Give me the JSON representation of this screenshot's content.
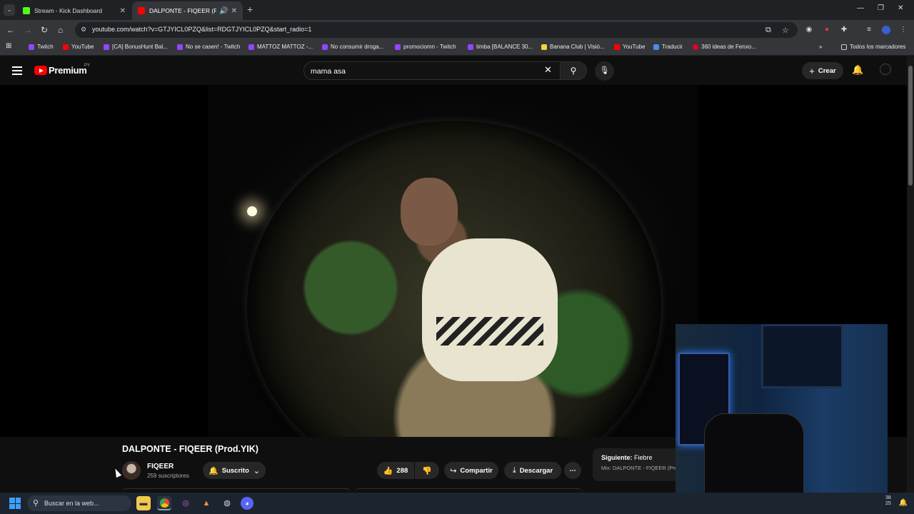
{
  "browser": {
    "tabs": [
      {
        "title": "Stream - Kick Dashboard",
        "icon": "kick-icon",
        "color": "#53fc18"
      },
      {
        "title": "DALPONTE - FIQEER (Prod.",
        "icon": "youtube-icon",
        "color": "#ff0000"
      }
    ],
    "url": "youtube.com/watch?v=GTJYICL0PZQ&list=RDGTJYICL0PZQ&start_radio=1",
    "bookmarks": [
      "Twitch",
      "YouTube",
      "[CA] BonusHunt Bal...",
      "No se casen! - Twitch",
      "MATTOZ MATTOZ -...",
      "No consumir droga...",
      "promociomn - Twitch",
      "timba [BALANCE 30...",
      "Banana Club | Visió...",
      "YouTube",
      "Traducir",
      "360 ideas de Fenxo..."
    ],
    "all_bookmarks": "Todos los marcadores"
  },
  "youtube": {
    "logo_text": "Premium",
    "country": "PY",
    "search_value": "mama asa",
    "create_label": "Crear",
    "video_title": "DALPONTE - FIQEER (Prod.YIK)",
    "channel_name": "FIQEER",
    "subscribers": "259 suscriptores",
    "subscribed_label": "Suscrito",
    "likes": "288",
    "share_label": "Compartir",
    "download_label": "Descargar",
    "up_next_prefix": "Siguiente:",
    "up_next_title": "Fiebre",
    "up_next_mix": "Mix: DALPONTE - FIQEER (Prod"
  },
  "taskbar": {
    "search_placeholder": "Buscar en la web...",
    "time_partial": "38",
    "date_partial": "25"
  }
}
